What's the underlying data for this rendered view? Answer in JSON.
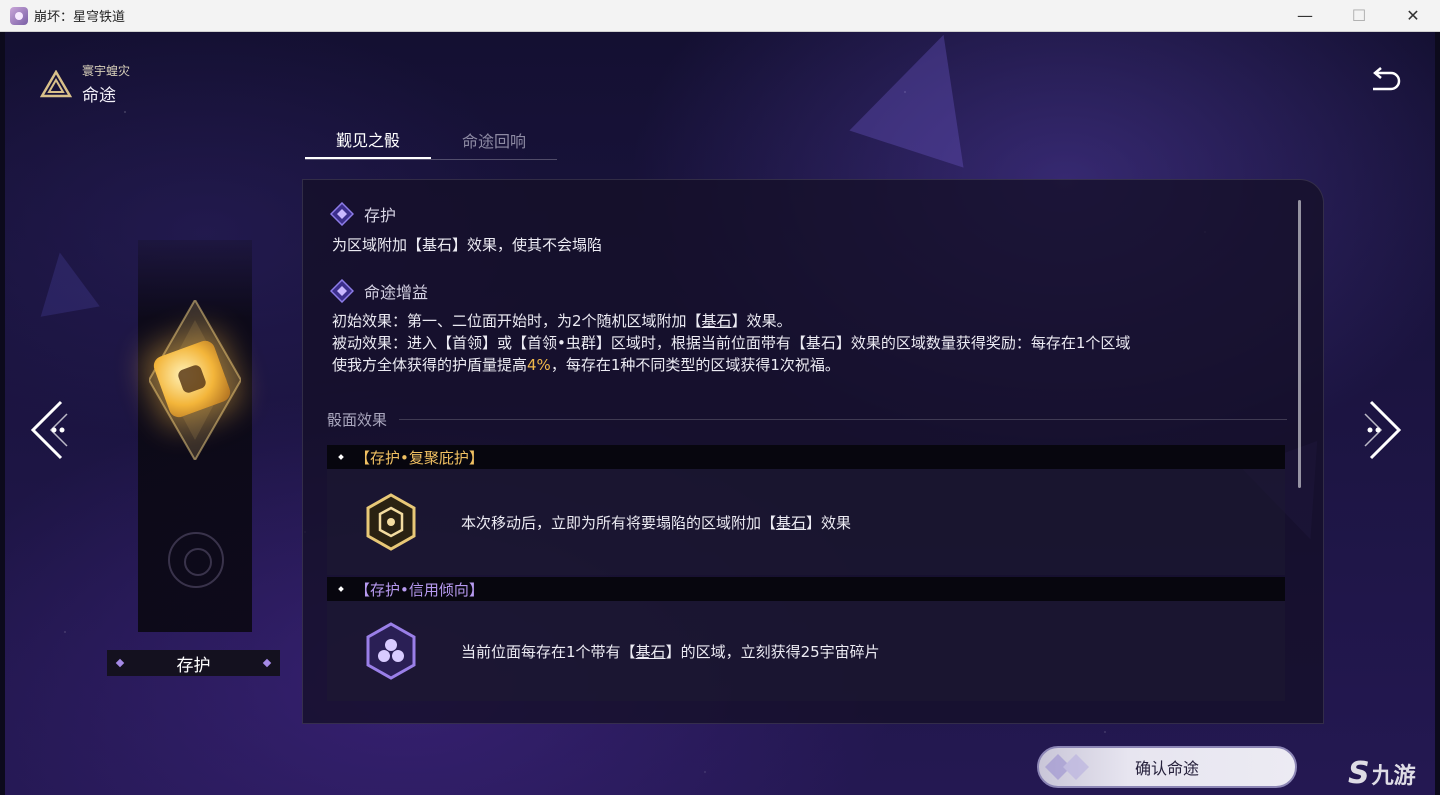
{
  "window": {
    "title": "崩坏：星穹铁道",
    "minimize_icon": "minimize-icon",
    "maximize_icon": "maximize-icon",
    "close_icon": "close-icon"
  },
  "header": {
    "subtitle": "寰宇蝗灾",
    "title": "命途",
    "logo_icon": "triangle-emblem-icon",
    "back_icon": "return-arrow-icon"
  },
  "tabs": [
    {
      "label": "觐见之骰",
      "active": true
    },
    {
      "label": "命途回响",
      "active": false
    }
  ],
  "card": {
    "name": "存护",
    "dice_icon": "golden-dice-icon",
    "faded_icon": "preservation-emblem-icon"
  },
  "nav": {
    "prev_icon": "chevron-left-icon",
    "next_icon": "chevron-right-icon"
  },
  "panel": {
    "section1": {
      "title": "存护",
      "desc": "为区域附加【基石】效果，使其不会塌陷"
    },
    "section2": {
      "title": "命途增益",
      "line1_prefix": "初始效果：第一、二位面开始时，为2个随机区域附加【",
      "line1_keyword": "基石",
      "line1_suffix": "】效果。",
      "line2": "被动效果：进入【首领】或【首领•虫群】区域时，根据当前位面带有【基石】效果的区域数量获得奖励：每存在1个区域",
      "line3_prefix": "使我方全体获得的护盾量提高",
      "line3_highlight": "4%",
      "line3_suffix": "，每存在1种不同类型的区域获得1次祝福。"
    },
    "dice_face_label": "骰面效果",
    "effects": [
      {
        "name": "【存护•复聚庇护】",
        "tier": "gold",
        "icon": "gold-hexagon-icon",
        "text_prefix": "本次移动后，立即为所有将要塌陷的区域附加【",
        "keyword": "基石",
        "text_suffix": "】效果"
      },
      {
        "name": "【存护•信用倾向】",
        "tier": "purple",
        "icon": "purple-hexagon-icon",
        "text_prefix": "当前位面每存在1个带有【",
        "keyword": "基石",
        "text_suffix": "】的区域，立刻获得25宇宙碎片"
      }
    ]
  },
  "confirm_button": "确认命途",
  "watermark": {
    "glyph": "S",
    "text": "九游"
  },
  "colors": {
    "accent_gold": "#f0b84a",
    "accent_purple": "#b79af0",
    "panel_bg": "#141028"
  }
}
